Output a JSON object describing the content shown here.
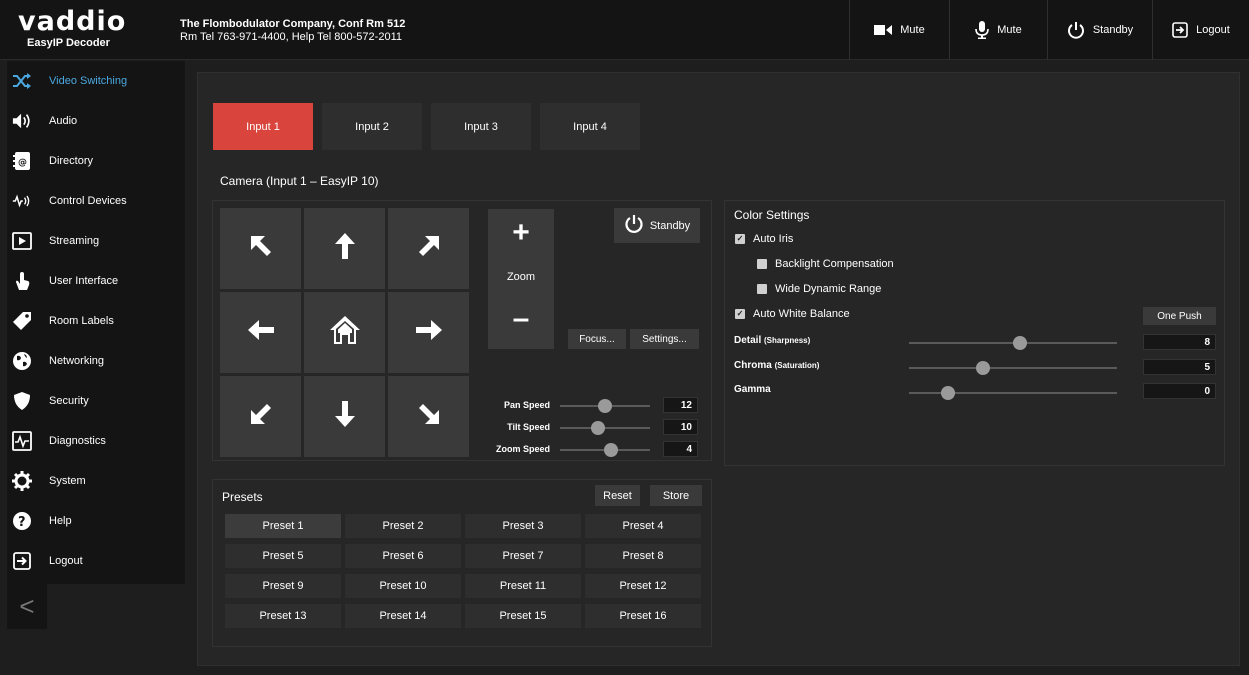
{
  "header": {
    "logo": "vaddio",
    "product": "EasyIP Decoder",
    "company_line1": "The Flombodulator Company, Conf Rm 512",
    "company_line2": "Rm Tel 763-971-4400, Help Tel 800-572-2011",
    "video_mute_label": "Mute",
    "audio_mute_label": "Mute",
    "standby_label": "Standby",
    "logout_label": "Logout"
  },
  "sidebar": {
    "items": [
      {
        "label": "Video Switching",
        "icon": "shuffle-icon",
        "active": true
      },
      {
        "label": "Audio",
        "icon": "speaker-icon"
      },
      {
        "label": "Directory",
        "icon": "directory-icon"
      },
      {
        "label": "Control Devices",
        "icon": "control-devices-icon"
      },
      {
        "label": "Streaming",
        "icon": "play-icon"
      },
      {
        "label": "User Interface",
        "icon": "touch-icon"
      },
      {
        "label": "Room Labels",
        "icon": "tag-icon"
      },
      {
        "label": "Networking",
        "icon": "globe-icon"
      },
      {
        "label": "Security",
        "icon": "shield-icon"
      },
      {
        "label": "Diagnostics",
        "icon": "pulse-icon"
      },
      {
        "label": "System",
        "icon": "gear-icon"
      },
      {
        "label": "Help",
        "icon": "help-icon"
      },
      {
        "label": "Logout",
        "icon": "logout-icon"
      }
    ],
    "collapse_glyph": "<"
  },
  "tabs": [
    {
      "label": "Input 1",
      "active": true
    },
    {
      "label": "Input 2"
    },
    {
      "label": "Input 3"
    },
    {
      "label": "Input 4"
    }
  ],
  "camera": {
    "title": "Camera (Input 1 – EasyIP 10)",
    "zoom_label": "Zoom",
    "zoom_in": "+",
    "zoom_out": "–",
    "standby_label": "Standby",
    "focus_label": "Focus...",
    "settings_label": "Settings...",
    "pan_speed_label": "Pan Speed",
    "pan_speed": 12,
    "tilt_speed_label": "Tilt Speed",
    "tilt_speed": 10,
    "zoom_speed_label": "Zoom Speed",
    "zoom_speed": 4
  },
  "color_settings": {
    "title": "Color Settings",
    "auto_iris_label": "Auto Iris",
    "auto_iris": true,
    "backlight_label": "Backlight Compensation",
    "backlight": false,
    "wdr_label": "Wide Dynamic Range",
    "wdr": false,
    "awb_label": "Auto White Balance",
    "awb": true,
    "one_push_label": "One Push",
    "detail_label": "Detail",
    "detail_sub": "(Sharpness)",
    "detail": 8,
    "chroma_label": "Chroma",
    "chroma_sub": "(Saturation)",
    "chroma": 5,
    "gamma_label": "Gamma",
    "gamma": 0
  },
  "presets": {
    "title": "Presets",
    "reset_label": "Reset",
    "store_label": "Store",
    "items": [
      "Preset 1",
      "Preset 2",
      "Preset 3",
      "Preset 4",
      "Preset 5",
      "Preset 6",
      "Preset 7",
      "Preset 8",
      "Preset 9",
      "Preset 10",
      "Preset 11",
      "Preset 12",
      "Preset 13",
      "Preset 14",
      "Preset 15",
      "Preset 16"
    ],
    "active_index": 0
  },
  "colors": {
    "accent": "#d9453d",
    "active_nav": "#4aa8e0",
    "background": "#1e1e1e"
  }
}
